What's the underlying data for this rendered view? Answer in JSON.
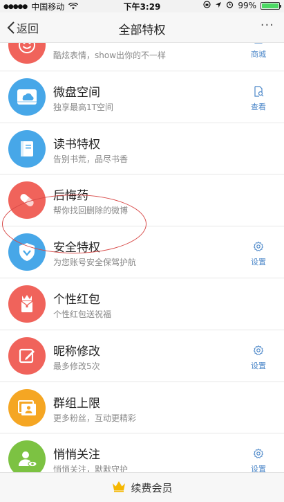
{
  "status_bar": {
    "carrier": "中国移动",
    "time": "下午3:29",
    "battery": "99%",
    "battery_level": 0.99
  },
  "nav": {
    "back_label": "返回",
    "title": "全部特权",
    "more_label": "···"
  },
  "items": [
    {
      "name": "",
      "desc": "酷炫表情，show出你的不一样",
      "action": "商城",
      "icon": "emoji-icon",
      "color": "#f0635b"
    },
    {
      "name": "微盘空间",
      "desc": "独享最高1T空间",
      "action": "查看",
      "icon": "cloud-drive-icon",
      "color": "#47a7e8"
    },
    {
      "name": "读书特权",
      "desc": "告别书荒，品尽书香",
      "action": "",
      "icon": "book-icon",
      "color": "#47a7e8"
    },
    {
      "name": "后悔药",
      "desc": "帮你找回删除的微博",
      "action": "",
      "icon": "pill-icon",
      "color": "#f0635b"
    },
    {
      "name": "安全特权",
      "desc": "为您账号安全保驾护航",
      "action": "设置",
      "icon": "shield-icon",
      "color": "#47a7e8"
    },
    {
      "name": "个性红包",
      "desc": "个性红包送祝福",
      "action": "",
      "icon": "red-packet-icon",
      "color": "#f0635b"
    },
    {
      "name": "昵称修改",
      "desc": "最多修改5次",
      "action": "设置",
      "icon": "edit-icon",
      "color": "#f0635b"
    },
    {
      "name": "群组上限",
      "desc": "更多粉丝，互动更精彩",
      "action": "",
      "icon": "group-icon",
      "color": "#f5a623"
    },
    {
      "name": "悄悄关注",
      "desc": "悄悄关注，默默守护",
      "action": "设置",
      "icon": "secret-follow-icon",
      "color": "#7cc242"
    }
  ],
  "footer": {
    "label": "续费会员",
    "icon": "crown-icon"
  },
  "colors": {
    "accent": "#4a86c8",
    "highlight_circle": "#d84a48"
  }
}
